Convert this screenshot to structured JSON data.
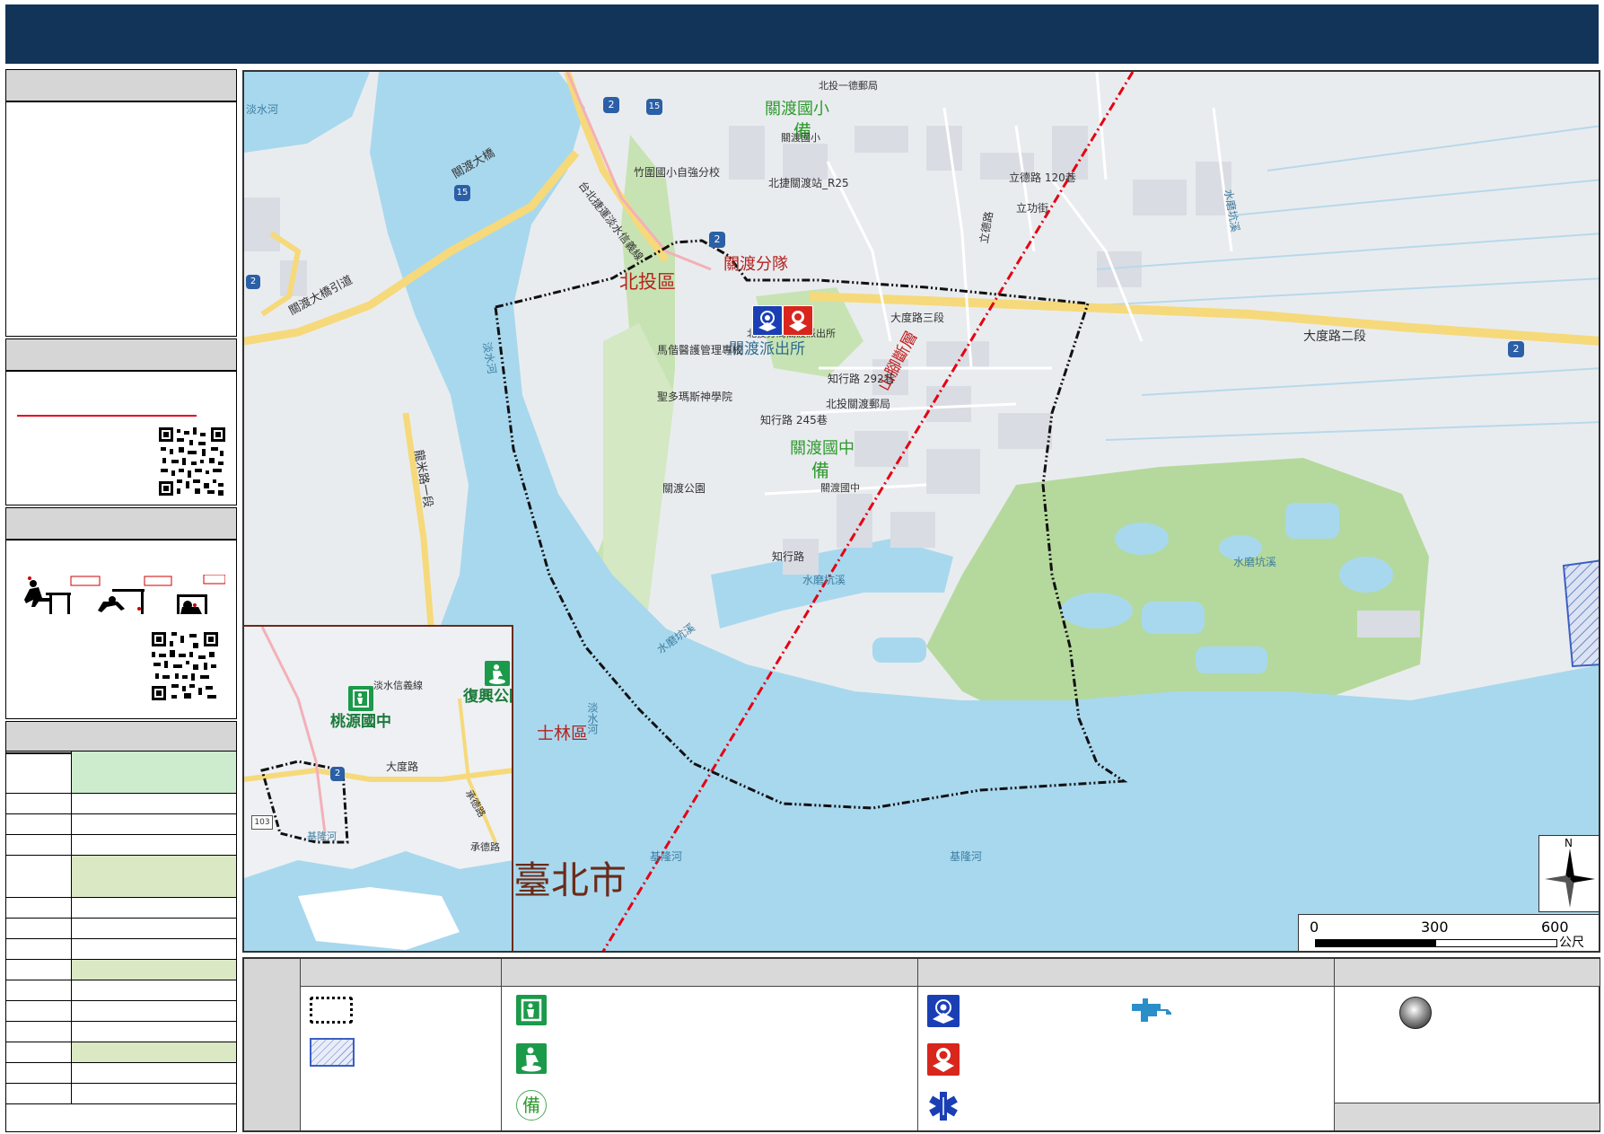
{
  "page": {
    "title": ""
  },
  "map": {
    "district_labels": {
      "beitou": "北投區",
      "shilin": "士林區",
      "taipei": "臺北市"
    },
    "facility_labels": {
      "police_unit": "關渡分隊",
      "police_station": "關渡派出所",
      "school_elementary": "關渡國小",
      "school_junior": "關渡國中",
      "backup_mark": "備"
    },
    "fault_label": "山腳斷層",
    "road_labels": {
      "dadu_3": "大度路三段",
      "dadu_2": "大度路二段",
      "zhixing_292": "知行路 292巷",
      "zhixing_245": "知行路 245巷",
      "zhixing": "知行路",
      "lide": "立德路",
      "lide_120": "立德路 120巷",
      "ligong": "立功街",
      "guandu_bridge": "關渡大橋",
      "guandu_bridge_approach": "關渡大橋引道",
      "longmi_1": "龍米路一段",
      "mrt": "台北捷運淡水信義線"
    },
    "poi_labels": {
      "mackay": "馬偕醫護管理專校",
      "seminary": "聖多瑪斯神學院",
      "guandu_park": "關渡公園",
      "post_office": "北投關渡郵局",
      "mrt_station": "北捷關渡站_R25",
      "zhuwei": "竹圍國小自強分校",
      "police_small": "北投分局關渡派出所",
      "elem_small": "關渡國小",
      "junior_small": "關渡國中",
      "post_beitou": "北投一德郵局"
    },
    "water_labels": {
      "tamsui_1": "淡水河",
      "tamsui_2": "淡水河",
      "tamsui_3": "淡水河",
      "keelung_1": "基隆河",
      "keelung_2": "基隆河",
      "shuimo_1": "水磨坑溪",
      "shuimo_2": "水磨坑溪",
      "shuimo_3": "水磨坑溪",
      "shuimo_4": "水磨坑溪"
    },
    "route_shields": [
      "2",
      "15",
      "15",
      "2",
      "2",
      "2"
    ],
    "scale_bar": {
      "ticks": [
        "0",
        "300",
        "600"
      ],
      "unit": "公尺"
    },
    "north_label": "N"
  },
  "inset": {
    "labels": {
      "taoyuan": "桃源國中",
      "fuxing": "復興公園",
      "dadu": "大度路",
      "chengde_1": "承德路",
      "chengde_2": "承德路",
      "mrt": "淡水信義線",
      "keelung": "基隆河",
      "shield_2": "2",
      "shield_103": "103"
    }
  },
  "colors": {
    "title_bar": "#123459",
    "water": "#a8d8ee",
    "land": "#e9ecef",
    "fault_line": "#e60012",
    "green_area": "#b5d99c",
    "police_blue": "#1a3fb5",
    "fire_red": "#d9261c",
    "shelter_green": "#1b9a4a",
    "highway_yellow": "#f6d97a"
  },
  "sidebar": {
    "table_rows": 16
  },
  "legend": {
    "icons": [
      "boundary-dashed",
      "hatched-area",
      "shelter-indoor-icon",
      "shelter-outdoor-icon",
      "backup-shelter-icon",
      "police-icon",
      "fire-station-icon",
      "medical-icon",
      "water-supply-icon",
      "dot-icon"
    ]
  }
}
